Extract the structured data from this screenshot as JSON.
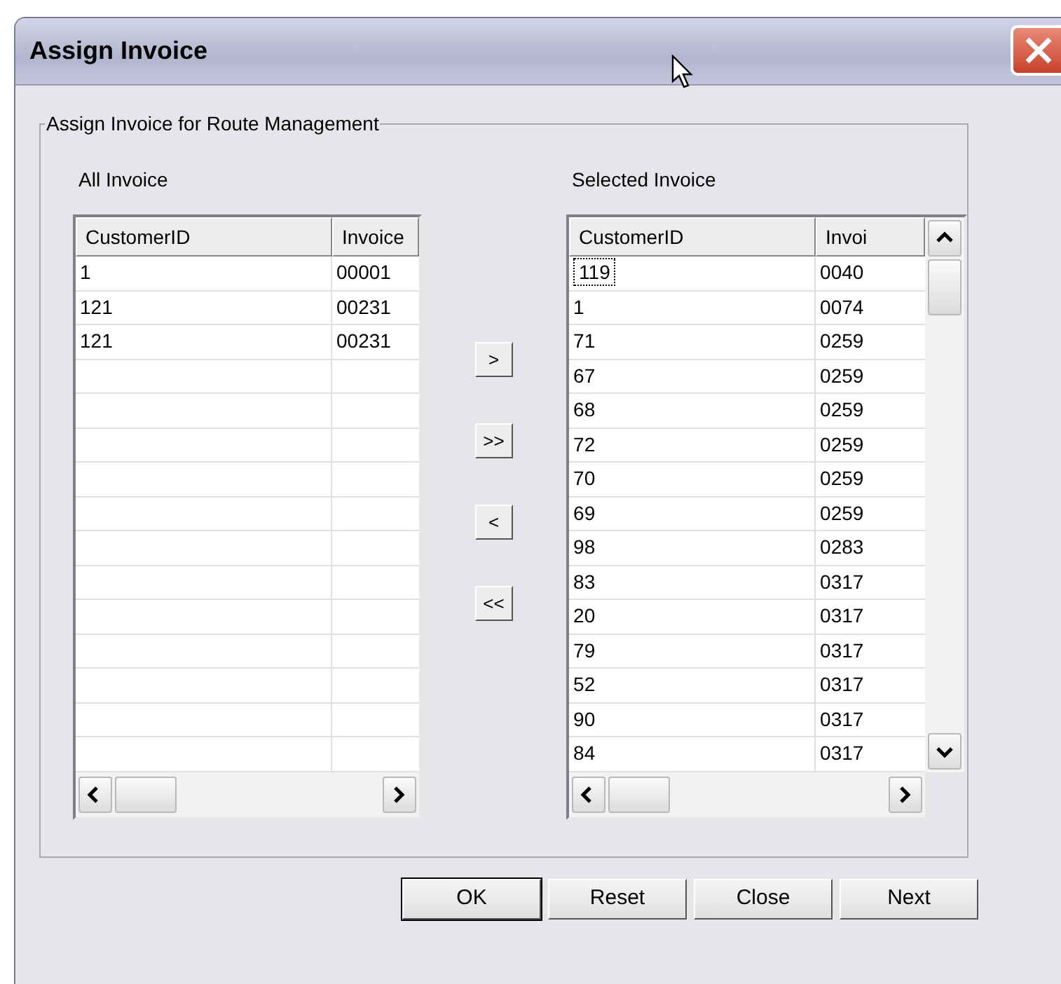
{
  "window": {
    "title": "Assign Invoice"
  },
  "group": {
    "title": "Assign Invoice for Route Management"
  },
  "lists": [
    {
      "label": "All Invoice",
      "columns": [
        "CustomerID",
        "Invoice"
      ],
      "rows": [
        {
          "cells": [
            "1",
            "00001"
          ],
          "focused": false
        },
        {
          "cells": [
            "121",
            "00231"
          ],
          "focused": false
        },
        {
          "cells": [
            "121",
            "00231"
          ],
          "focused": false
        }
      ]
    },
    {
      "label": "Selected Invoice",
      "columns": [
        "CustomerID",
        "Invoi"
      ],
      "rows": [
        {
          "cells": [
            "119",
            "0040"
          ],
          "focused": true
        },
        {
          "cells": [
            "1",
            "0074"
          ],
          "focused": false
        },
        {
          "cells": [
            "71",
            "0259"
          ],
          "focused": false
        },
        {
          "cells": [
            "67",
            "0259"
          ],
          "focused": false
        },
        {
          "cells": [
            "68",
            "0259"
          ],
          "focused": false
        },
        {
          "cells": [
            "72",
            "0259"
          ],
          "focused": false
        },
        {
          "cells": [
            "70",
            "0259"
          ],
          "focused": false
        },
        {
          "cells": [
            "69",
            "0259"
          ],
          "focused": false
        },
        {
          "cells": [
            "98",
            "0283"
          ],
          "focused": false
        },
        {
          "cells": [
            "83",
            "0317"
          ],
          "focused": false
        },
        {
          "cells": [
            "20",
            "0317"
          ],
          "focused": false
        },
        {
          "cells": [
            "79",
            "0317"
          ],
          "focused": false
        },
        {
          "cells": [
            "52",
            "0317"
          ],
          "focused": false
        },
        {
          "cells": [
            "90",
            "0317"
          ],
          "focused": false
        },
        {
          "cells": [
            "84",
            "0317"
          ],
          "focused": false
        }
      ]
    }
  ],
  "transfer_buttons": [
    ">",
    ">>",
    "<",
    "<<"
  ],
  "buttons": [
    {
      "label": "OK",
      "default": true
    },
    {
      "label": "Reset",
      "default": false
    },
    {
      "label": "Close",
      "default": false
    },
    {
      "label": "Next",
      "default": false
    }
  ]
}
